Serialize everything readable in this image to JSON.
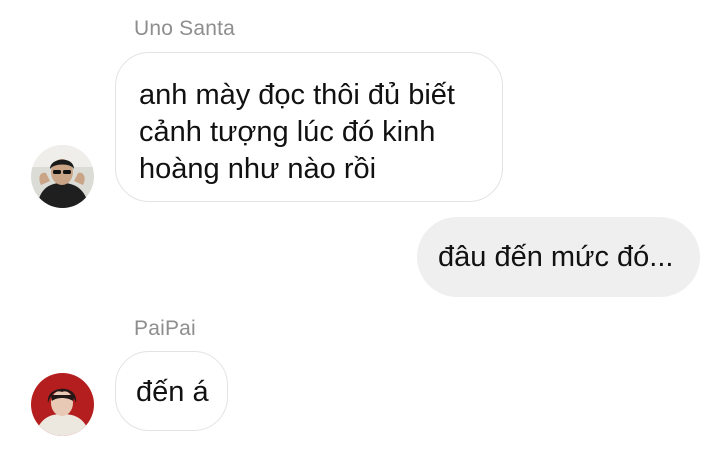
{
  "messages": [
    {
      "sender": "Uno Santa",
      "direction": "incoming",
      "avatar": "profile-photo-dark",
      "lines": [
        "anh mày đọc thôi đủ biết",
        "cảnh tượng lúc đó kinh",
        "hoàng như nào rồi"
      ]
    },
    {
      "direction": "outgoing",
      "lines": [
        "đâu đến mức đó..."
      ]
    },
    {
      "sender": "PaiPai",
      "direction": "incoming",
      "avatar": "profile-photo-red",
      "lines": [
        "đến á"
      ]
    }
  ],
  "colors": {
    "incoming_bubble_bg": "#ffffff",
    "incoming_bubble_border": "#e3e3e3",
    "outgoing_bubble_bg": "#efefef",
    "sender_name": "#8e8e8e",
    "message_text": "#111111"
  }
}
